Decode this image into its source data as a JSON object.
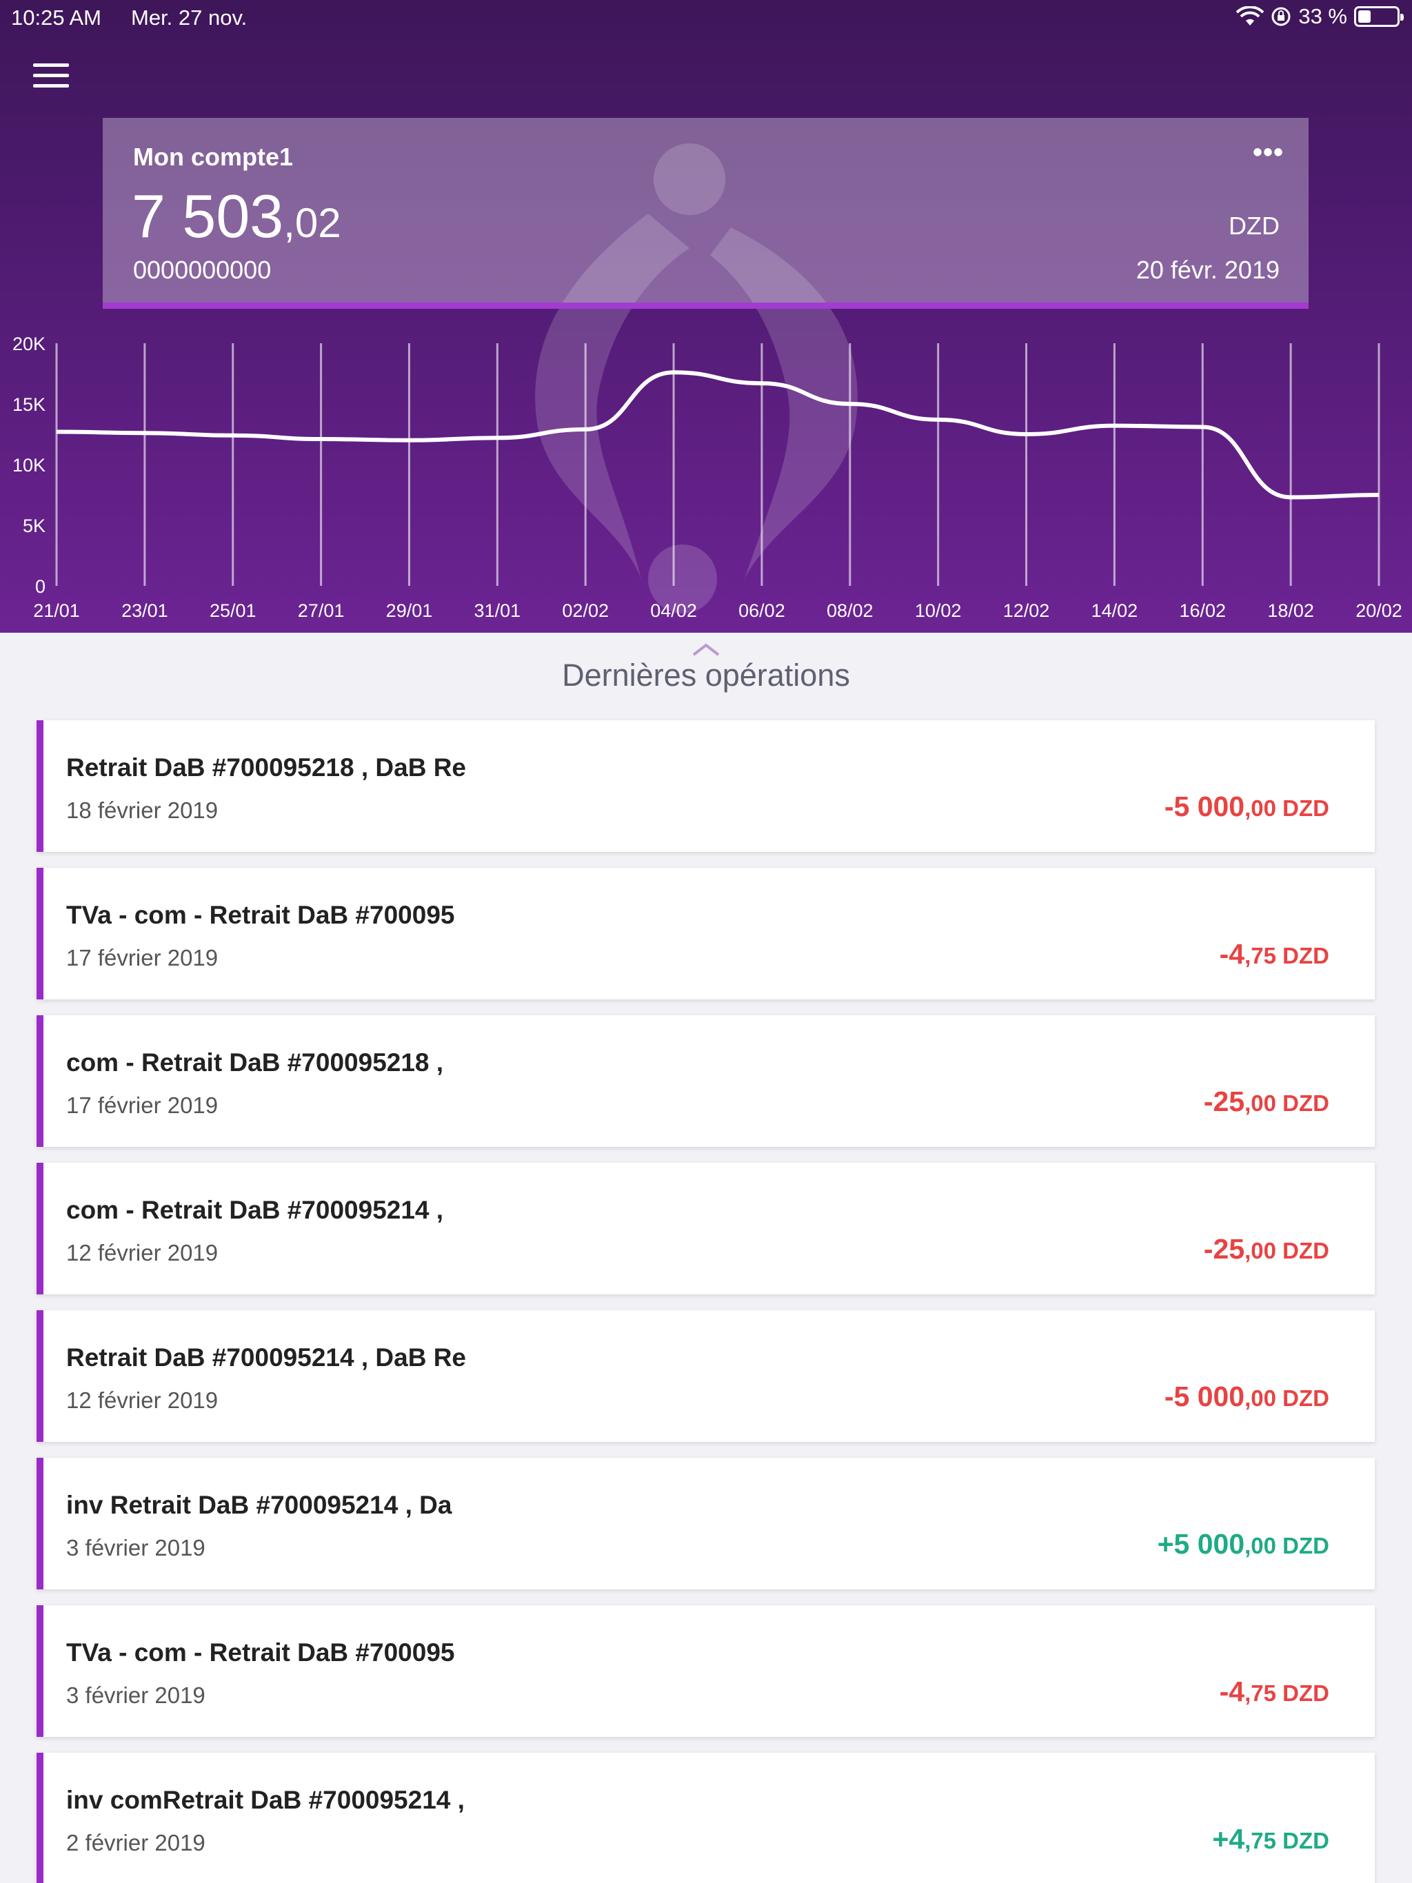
{
  "status_bar": {
    "time": "10:25 AM",
    "date": "Mer. 27 nov.",
    "battery": "33 %",
    "battery_level": 0.33
  },
  "account": {
    "name": "Mon compte1",
    "balance_int": "7 503",
    "balance_dec": ",02",
    "number": "0000000000",
    "currency": "DZD",
    "date": "20 févr. 2019",
    "more_label": "•••"
  },
  "chart_data": {
    "type": "line",
    "x": [
      "21/01",
      "23/01",
      "25/01",
      "27/01",
      "29/01",
      "31/01",
      "02/02",
      "04/02",
      "06/02",
      "08/02",
      "10/02",
      "12/02",
      "14/02",
      "16/02",
      "18/02",
      "20/02"
    ],
    "y_ticks": [
      "0",
      "5K",
      "10K",
      "15K",
      "20K"
    ],
    "ylim": [
      0,
      20000
    ],
    "series": [
      {
        "values": [
          12700,
          12600,
          12400,
          12100,
          12000,
          12200,
          12900,
          17600,
          16700,
          15000,
          13700,
          12500,
          13200,
          13100,
          7300,
          7500
        ]
      }
    ],
    "grid": "vertical"
  },
  "operations_title": "Dernières opérations",
  "operations": [
    {
      "label": "Retrait DaB #700095218 , DaB Re",
      "date": "18 février 2019",
      "amount_int": "-5 000",
      "amount_dec": ",00",
      "currency": "DZD",
      "sign": "neg"
    },
    {
      "label": "TVa - com - Retrait DaB #700095",
      "date": "17 février 2019",
      "amount_int": "-4",
      "amount_dec": ",75",
      "currency": "DZD",
      "sign": "neg"
    },
    {
      "label": "com - Retrait DaB #700095218 ,",
      "date": "17 février 2019",
      "amount_int": "-25",
      "amount_dec": ",00",
      "currency": "DZD",
      "sign": "neg"
    },
    {
      "label": "com - Retrait DaB #700095214 ,",
      "date": "12 février 2019",
      "amount_int": "-25",
      "amount_dec": ",00",
      "currency": "DZD",
      "sign": "neg"
    },
    {
      "label": "Retrait DaB #700095214 , DaB Re",
      "date": "12 février 2019",
      "amount_int": "-5 000",
      "amount_dec": ",00",
      "currency": "DZD",
      "sign": "neg"
    },
    {
      "label": "inv Retrait DaB #700095214 , Da",
      "date": "3 février 2019",
      "amount_int": "+5 000",
      "amount_dec": ",00",
      "currency": "DZD",
      "sign": "pos"
    },
    {
      "label": "TVa - com - Retrait DaB #700095",
      "date": "3 février 2019",
      "amount_int": "-4",
      "amount_dec": ",75",
      "currency": "DZD",
      "sign": "neg"
    },
    {
      "label": "inv comRetrait DaB #700095214 ,",
      "date": "2 février 2019",
      "amount_int": "+4",
      "amount_dec": ",75",
      "currency": "DZD",
      "sign": "pos"
    }
  ]
}
